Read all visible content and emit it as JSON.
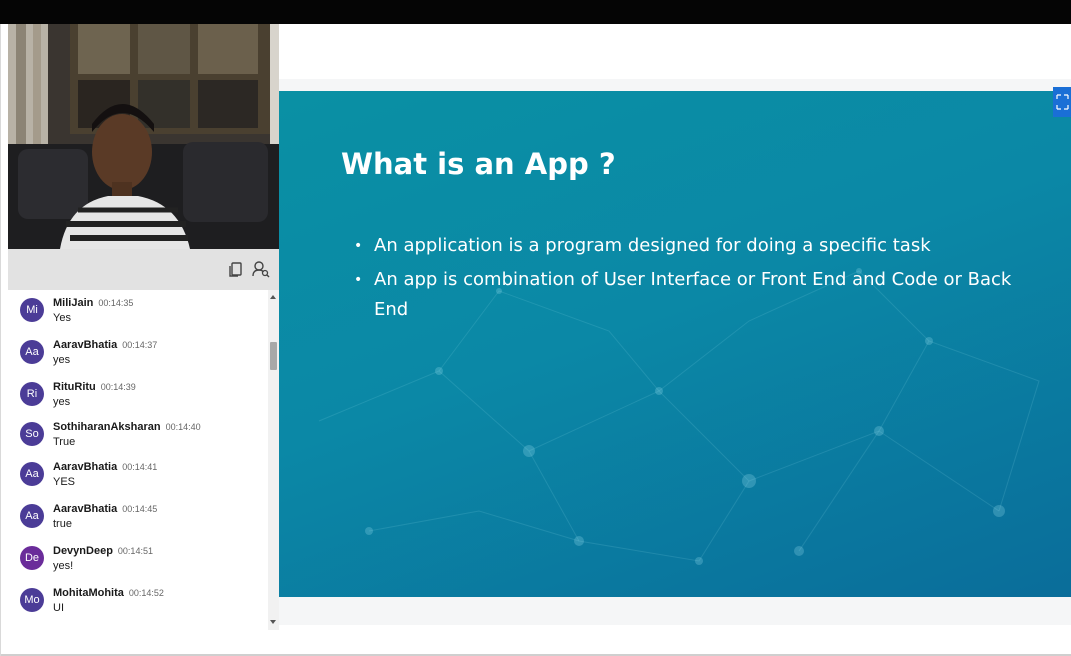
{
  "toolbar": {
    "icons": [
      "copy-icon",
      "search-user-icon"
    ]
  },
  "chat": {
    "messages": [
      {
        "initials": "Mi",
        "name": "MiliJain",
        "time": "00:14:35",
        "text": "Yes"
      },
      {
        "initials": "Aa",
        "name": "AaravBhatia",
        "time": "00:14:37",
        "text": "yes"
      },
      {
        "initials": "Ri",
        "name": "RituRitu",
        "time": "00:14:39",
        "text": "yes"
      },
      {
        "initials": "So",
        "name": "SothiharanAksharan",
        "time": "00:14:40",
        "text": "True"
      },
      {
        "initials": "Aa",
        "name": "AaravBhatia",
        "time": "00:14:41",
        "text": "YES"
      },
      {
        "initials": "Aa",
        "name": "AaravBhatia",
        "time": "00:14:45",
        "text": "true"
      },
      {
        "initials": "De",
        "name": "DevynDeep",
        "time": "00:14:51",
        "text": "yes!"
      },
      {
        "initials": "Mo",
        "name": "MohitaMohita",
        "time": "00:14:52",
        "text": "UI"
      }
    ]
  },
  "slide": {
    "title": "What is an App ?",
    "bullets": [
      "An application is a program designed for doing a specific task",
      "An app is combination of User Interface or Front End and Code or Back End"
    ]
  },
  "colors": {
    "slide_background": "#0a8aa6",
    "avatar": "#4b3c97",
    "avatar_alt": "#6a2c9a",
    "fullscreen_button": "#1a6fd6"
  }
}
